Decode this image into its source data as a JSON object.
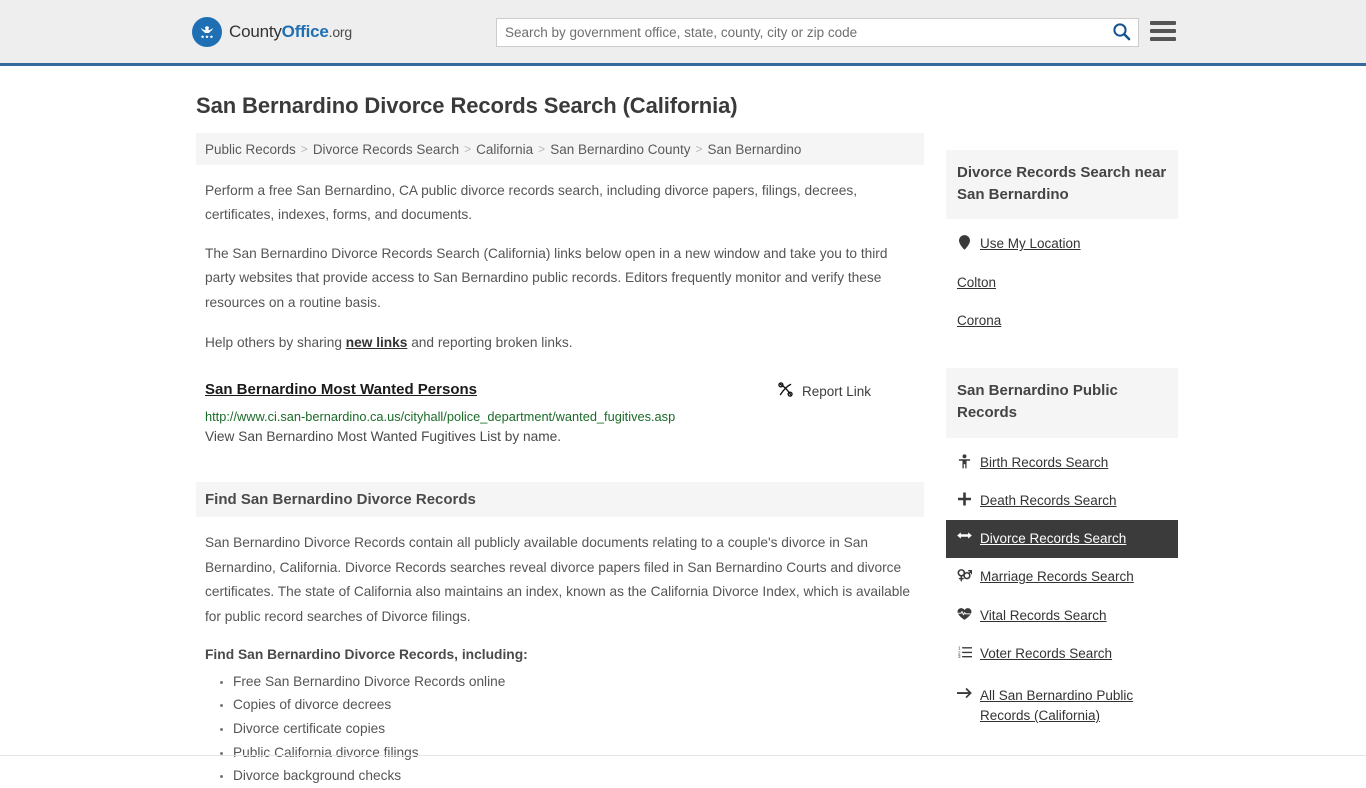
{
  "header": {
    "brand": {
      "part1": "County",
      "part2": "Office",
      "part3": ".org",
      "logo_icon": "eagle-stars-logo"
    },
    "search": {
      "placeholder": "Search by government office, state, county, city or zip code",
      "value": "",
      "search_icon": "search-icon"
    },
    "menu_icon": "hamburger-menu-icon",
    "accent_color": "#36699e"
  },
  "page": {
    "title": "San Bernardino Divorce Records Search (California)"
  },
  "breadcrumb": {
    "items": [
      {
        "label": "Public Records"
      },
      {
        "label": "Divorce Records Search"
      },
      {
        "label": "California"
      },
      {
        "label": "San Bernardino County"
      },
      {
        "label": "San Bernardino"
      }
    ],
    "separator": ">"
  },
  "intro": {
    "p1": "Perform a free San Bernardino, CA public divorce records search, including divorce papers, filings, decrees, certificates, indexes, forms, and documents.",
    "p2": "The San Bernardino Divorce Records Search (California) links below open in a new window and take you to third party websites that provide access to San Bernardino public records. Editors frequently monitor and verify these resources on a routine basis.",
    "p3_before": "Help others by sharing ",
    "p3_link": "new links",
    "p3_after": " and reporting broken links."
  },
  "result": {
    "title": "San Bernardino Most Wanted Persons",
    "url": "http://www.ci.san-bernardino.ca.us/cityhall/police_department/wanted_fugitives.asp",
    "description": "View San Bernardino Most Wanted Fugitives List by name.",
    "report_label": "Report Link",
    "report_icon": "broken-link-icon"
  },
  "section": {
    "heading": "Find San Bernardino Divorce Records",
    "body": "San Bernardino Divorce Records contain all publicly available documents relating to a couple's divorce in San Bernardino, California. Divorce Records searches reveal divorce papers filed in San Bernardino Courts and divorce certificates. The state of California also maintains an index, known as the California Divorce Index, which is available for public record searches of Divorce filings.",
    "list_heading": "Find San Bernardino Divorce Records, including:",
    "bullets": [
      "Free San Bernardino Divorce Records online",
      "Copies of divorce decrees",
      "Divorce certificate copies",
      "Public California divorce filings",
      "Divorce background checks"
    ]
  },
  "sidebar": {
    "near_card": {
      "title": "Divorce Records Search near San Bernardino",
      "links": [
        {
          "label": "Use My Location",
          "icon": "map-pin-icon"
        },
        {
          "label": "Colton",
          "icon": ""
        },
        {
          "label": "Corona",
          "icon": ""
        }
      ]
    },
    "records_card": {
      "title": "San Bernardino Public Records",
      "links": [
        {
          "label": "Birth Records Search",
          "icon": "baby-icon",
          "active": false
        },
        {
          "label": "Death Records Search",
          "icon": "cross-icon",
          "active": false
        },
        {
          "label": "Divorce Records Search",
          "icon": "arrows-left-right-icon",
          "active": true
        },
        {
          "label": "Marriage Records Search",
          "icon": "venus-mars-icon",
          "active": false
        },
        {
          "label": "Vital Records Search",
          "icon": "heartbeat-icon",
          "active": false
        },
        {
          "label": "Voter Records Search",
          "icon": "ordered-list-icon",
          "active": false
        },
        {
          "label": "All San Bernardino Public Records (California)",
          "icon": "arrow-right-icon",
          "active": false
        }
      ],
      "active_bg": "#3b3b3b"
    }
  }
}
